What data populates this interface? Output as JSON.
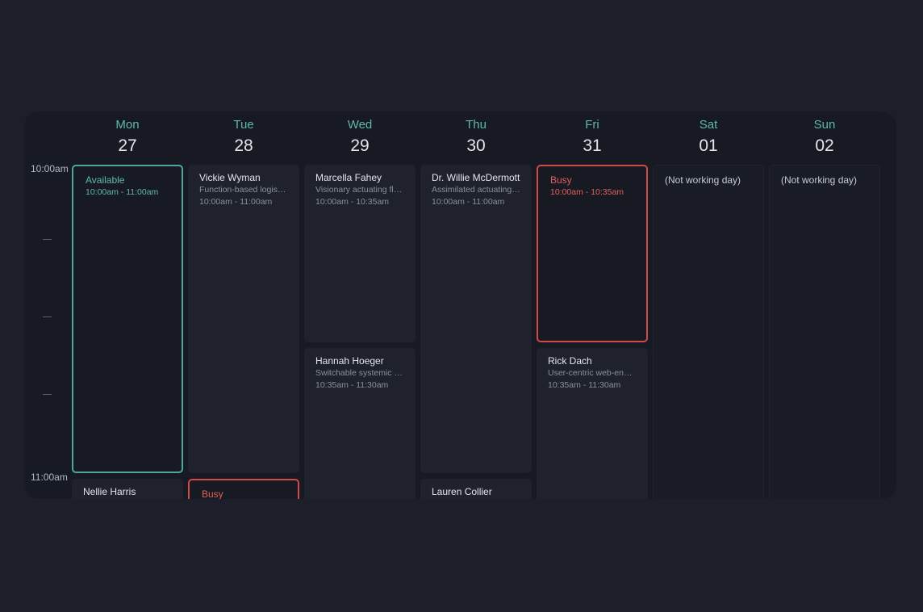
{
  "days": [
    {
      "name": "Mon",
      "num": "27"
    },
    {
      "name": "Tue",
      "num": "28"
    },
    {
      "name": "Wed",
      "num": "29"
    },
    {
      "name": "Thu",
      "num": "30"
    },
    {
      "name": "Fri",
      "num": "31"
    },
    {
      "name": "Sat",
      "num": "01"
    },
    {
      "name": "Sun",
      "num": "02"
    }
  ],
  "times": {
    "t1000": "10:00am",
    "t1100": "11:00am"
  },
  "events": {
    "mon": {
      "available": {
        "title": "Available",
        "time": "10:00am - 11:00am"
      },
      "nellie": {
        "title": "Nellie Harris"
      }
    },
    "tue": {
      "vickie": {
        "title": "Vickie Wyman",
        "desc": "Function-based logistical",
        "time": "10:00am - 11:00am"
      },
      "busy": {
        "title": "Busy"
      }
    },
    "wed": {
      "marcella": {
        "title": "Marcella Fahey",
        "desc": "Visionary actuating flexibility",
        "time": "10:00am - 10:35am"
      },
      "hannah": {
        "title": "Hannah Hoeger",
        "desc": "Switchable systemic support",
        "time": "10:35am - 11:30am"
      }
    },
    "thu": {
      "willie": {
        "title": "Dr. Willie McDermott",
        "desc": "Assimilated actuating matrix",
        "time": "10:00am - 11:00am"
      },
      "lauren": {
        "title": "Lauren Collier"
      }
    },
    "fri": {
      "busy": {
        "title": "Busy",
        "time": "10:00am - 10:35am"
      },
      "rick": {
        "title": "Rick Dach",
        "desc": "User-centric web-enabled",
        "time": "10:35am - 11:30am"
      }
    },
    "sat": {
      "off": {
        "title": "(Not working day)"
      }
    },
    "sun": {
      "off": {
        "title": "(Not working day)"
      }
    }
  },
  "colors": {
    "background": "#1c1f29",
    "panel": "#171a22",
    "accent_teal": "#5fb8ad",
    "busy_red": "#cf4a48"
  }
}
